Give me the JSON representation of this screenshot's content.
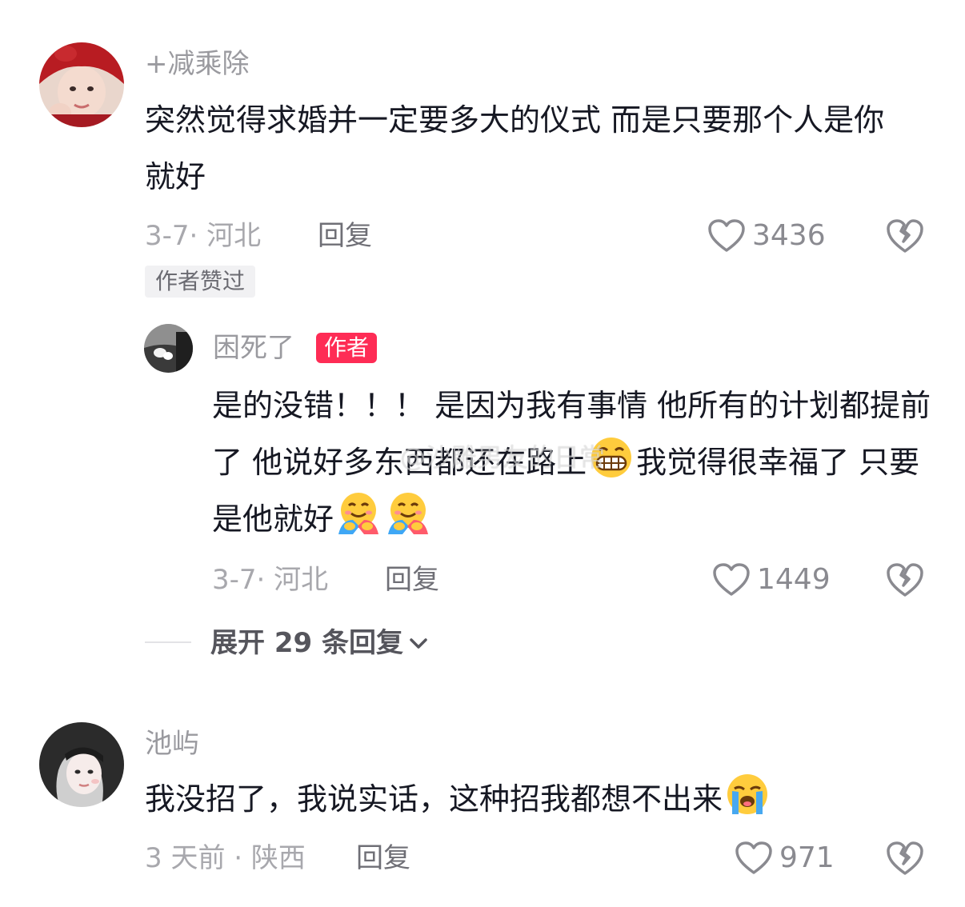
{
  "comments": [
    {
      "username": "+减乘除",
      "text": "突然觉得求婚并一定要多大的仪式 而是只要那个人是你就好",
      "date_location": "3-7· 河北",
      "reply_label": "回复",
      "likes": "3436",
      "tag": "作者赞过",
      "replies": [
        {
          "username": "困死了",
          "badge": "作者",
          "text_1": "是的没错！！！ 是因为我有事情 他所有的计划都提前了 他说好多东西都还在路上",
          "text_2": "我觉得很幸福了 只要是他就好",
          "date_location": "3-7· 河北",
          "reply_label": "回复",
          "likes": "1449"
        }
      ],
      "expand_label": "展开 29 条回复"
    },
    {
      "username": "池屿",
      "text": "我没招了，我说实话，这种招我都想不出来",
      "date_location": "3 天前 · 陕西",
      "reply_label": "回复",
      "likes": "971"
    }
  ],
  "watermark": "@沙雕男友的日常",
  "icons": {
    "like": "heart-outline-icon",
    "dislike": "broken-heart-icon",
    "expand": "chevron-down-icon",
    "emoji_grin": "grinning-face-emoji",
    "emoji_hug": "hugging-face-emoji",
    "emoji_cry": "loudly-crying-face-emoji"
  },
  "colors": {
    "author_badge": "#fe2c55",
    "text_primary": "#161823",
    "text_secondary": "#a8a8ad"
  }
}
